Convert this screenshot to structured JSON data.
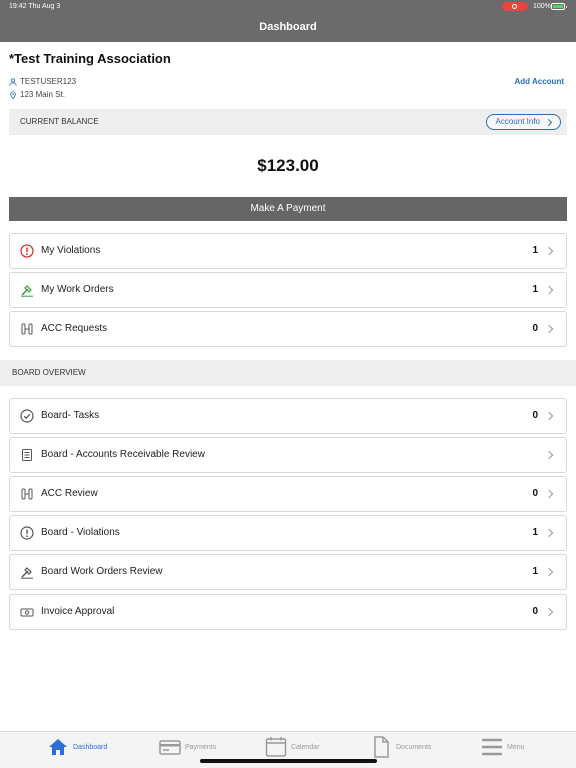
{
  "status": {
    "time": "19:42  Thu Aug 3",
    "battery": "100%"
  },
  "header": {
    "title": "Dashboard"
  },
  "association": {
    "name": "*Test Training Association",
    "user": "TESTUSER123",
    "address": "123 Main St.",
    "add_account": "Add Account"
  },
  "balance": {
    "label": "CURRENT BALANCE",
    "account_info": "Account Info",
    "amount": "$123.00",
    "pay_button": "Make A Payment"
  },
  "my_items": [
    {
      "label": "My Violations",
      "count": "1",
      "icon": "alert-circle-icon"
    },
    {
      "label": "My Work Orders",
      "count": "1",
      "icon": "hammer-icon"
    },
    {
      "label": "ACC Requests",
      "count": "0",
      "icon": "architecture-icon"
    }
  ],
  "board_overview": {
    "title": "BOARD OVERVIEW",
    "items": [
      {
        "label": "Board- Tasks",
        "count": "0",
        "icon": "check-circle-icon"
      },
      {
        "label": "Board - Accounts Receivable Review",
        "count": "",
        "icon": "ledger-icon"
      },
      {
        "label": "ACC Review",
        "count": "0",
        "icon": "architecture-icon"
      },
      {
        "label": "Board - Violations",
        "count": "1",
        "icon": "alert-circle-icon"
      },
      {
        "label": "Board Work Orders Review",
        "count": "1",
        "icon": "hammer-icon"
      },
      {
        "label": "Invoice Approval",
        "count": "0",
        "icon": "money-icon"
      }
    ]
  },
  "tabs": [
    {
      "label": "Dashboard",
      "icon": "home-icon",
      "active": true
    },
    {
      "label": "Payments",
      "icon": "credit-card-icon",
      "active": false
    },
    {
      "label": "Calendar",
      "icon": "calendar-icon",
      "active": false
    },
    {
      "label": "Documents",
      "icon": "document-icon",
      "active": false
    },
    {
      "label": "Menu",
      "icon": "menu-icon",
      "active": false
    }
  ],
  "colors": {
    "header": "#6b6b6b",
    "accent": "#2a6fb0",
    "violation": "#d9342b",
    "work_order": "#3a9a3a",
    "tab_active": "#2a6fd6"
  }
}
